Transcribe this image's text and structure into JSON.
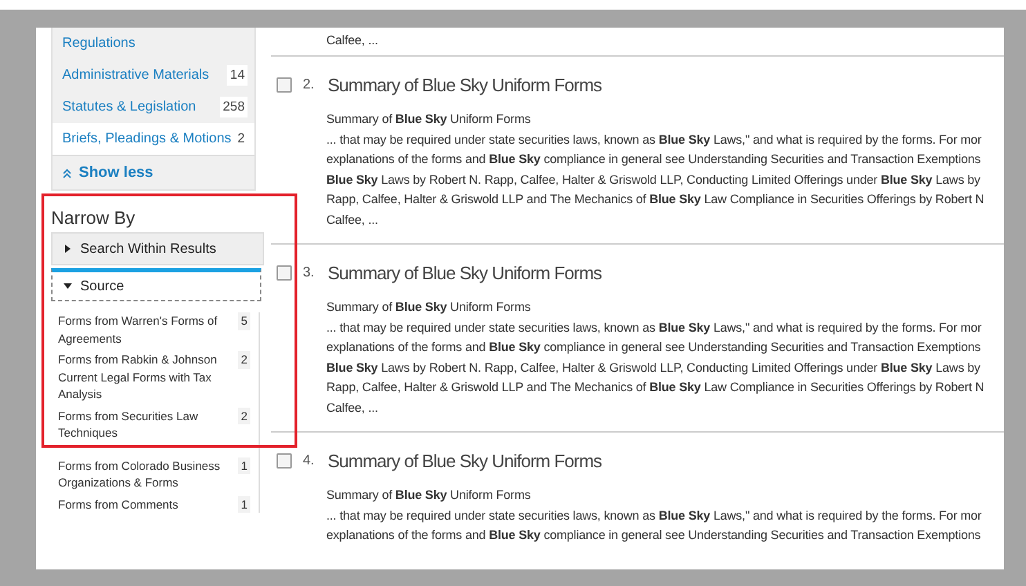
{
  "facets": [
    {
      "label": "Regulations",
      "selected": false
    },
    {
      "label": "Administrative Materials",
      "count": "14",
      "selected": false
    },
    {
      "label": "Statutes & Legislation",
      "count": "258",
      "selected": false
    },
    {
      "label": "Briefs, Pleadings & Motions",
      "count": "2",
      "selected": true
    }
  ],
  "show_less": "Show less",
  "narrow_by": {
    "title": "Narrow By",
    "sections": [
      {
        "label": "Search Within Results",
        "expanded": false
      },
      {
        "label": "Source",
        "expanded": true,
        "items": [
          {
            "label": "Forms from Warren's Forms of Agreements",
            "count": "5"
          },
          {
            "label": "Forms from Rabkin & Johnson Current Legal Forms with Tax Analysis",
            "count": "2"
          },
          {
            "label": "Forms from Securities Law Techniques",
            "count": "2"
          },
          {
            "label": "Forms from Colorado Business Organizations & Forms",
            "count": "1"
          },
          {
            "label": "Forms from Comments",
            "count": "1"
          }
        ]
      }
    ]
  },
  "previous_tail": "Calfee, ...",
  "results": [
    {
      "number": "2.",
      "title": "Summary of Blue Sky Uniform Forms",
      "checked": false,
      "lines": [
        "Summary of **Blue Sky** Uniform Forms",
        "... that may be required under state securities laws, known as **Blue Sky** Laws,\" and what is required by the forms. For mor",
        "explanations of the forms and **Blue Sky** compliance in general see Understanding Securities and Transaction Exemptions",
        "**Blue Sky** Laws by Robert N. Rapp, Calfee, Halter & Griswold LLP, Conducting Limited Offerings under **Blue Sky** Laws by",
        "Rapp, Calfee, Halter & Griswold LLP and The Mechanics of **Blue Sky** Law Compliance in Securities Offerings by Robert N",
        "Calfee, ..."
      ]
    },
    {
      "number": "3.",
      "title": "Summary of Blue Sky Uniform Forms",
      "checked": false,
      "lines": [
        "Summary of **Blue Sky** Uniform Forms",
        "... that may be required under state securities laws, known as **Blue Sky** Laws,\" and what is required by the forms. For mor",
        "explanations of the forms and **Blue Sky** compliance in general see Understanding Securities and Transaction Exemptions",
        "**Blue Sky** Laws by Robert N. Rapp, Calfee, Halter & Griswold LLP, Conducting Limited Offerings under **Blue Sky** Laws by",
        "Rapp, Calfee, Halter & Griswold LLP and The Mechanics of **Blue Sky** Law Compliance in Securities Offerings by Robert N",
        "Calfee, ..."
      ]
    },
    {
      "number": "4.",
      "title": "Summary of Blue Sky Uniform Forms",
      "checked": false,
      "lines": [
        "Summary of **Blue Sky** Uniform Forms",
        "... that may be required under state securities laws, known as **Blue Sky** Laws,\" and what is required by the forms. For mor",
        "explanations of the forms and **Blue Sky** compliance in general see Understanding Securities and Transaction Exemptions"
      ]
    }
  ]
}
